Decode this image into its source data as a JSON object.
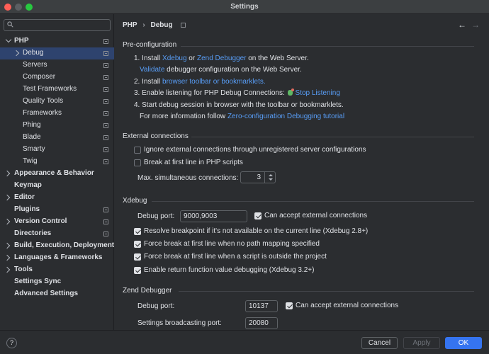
{
  "window": {
    "title": "Settings"
  },
  "search": {
    "placeholder": "",
    "value": ""
  },
  "sidebar": {
    "items": [
      {
        "label": "PHP"
      },
      {
        "label": "Debug"
      },
      {
        "label": "Servers"
      },
      {
        "label": "Composer"
      },
      {
        "label": "Test Frameworks"
      },
      {
        "label": "Quality Tools"
      },
      {
        "label": "Frameworks"
      },
      {
        "label": "Phing"
      },
      {
        "label": "Blade"
      },
      {
        "label": "Smarty"
      },
      {
        "label": "Twig"
      },
      {
        "label": "Appearance & Behavior"
      },
      {
        "label": "Keymap"
      },
      {
        "label": "Editor"
      },
      {
        "label": "Plugins"
      },
      {
        "label": "Version Control"
      },
      {
        "label": "Directories"
      },
      {
        "label": "Build, Execution, Deployment"
      },
      {
        "label": "Languages & Frameworks"
      },
      {
        "label": "Tools"
      },
      {
        "label": "Settings Sync"
      },
      {
        "label": "Advanced Settings"
      }
    ]
  },
  "breadcrumb": {
    "parent": "PHP",
    "separator": "›",
    "current": "Debug"
  },
  "nav": {
    "back": "←",
    "forward": "→"
  },
  "preconfig": {
    "title": "Pre-configuration",
    "step1": {
      "a": "1. Install ",
      "xdebug": "Xdebug",
      "or": " or ",
      "zend": "Zend Debugger",
      "b": " on the Web Server."
    },
    "step1b": {
      "validate": "Validate",
      "rest": " debugger configuration on the Web Server."
    },
    "step2": {
      "a": "2. Install ",
      "link": "browser toolbar or bookmarklets."
    },
    "step3": {
      "a": "3. Enable listening for PHP Debug Connections: ",
      "link": "Stop Listening"
    },
    "step4": {
      "a": "4. Start debug session in browser with the toolbar or bookmarklets."
    },
    "step4b": {
      "a": "For more information follow ",
      "link": "Zero-configuration Debugging tutorial"
    }
  },
  "external": {
    "title": "External connections",
    "ignore_label": "Ignore external connections through unregistered server configurations",
    "ignore_checked": false,
    "break_label": "Break at first line in PHP scripts",
    "break_checked": false,
    "max_label": "Max. simultaneous connections:",
    "max_value": "3"
  },
  "xdebug": {
    "title": "Xdebug",
    "port_label": "Debug port:",
    "port_value": "9000,9003",
    "accept_label": "Can accept external connections",
    "accept_checked": true,
    "resolve_label": "Resolve breakpoint if it's not available on the current line (Xdebug 2.8+)",
    "resolve_checked": true,
    "force1_label": "Force break at first line when no path mapping specified",
    "force1_checked": true,
    "force2_label": "Force break at first line when a script is outside the project",
    "force2_checked": true,
    "ret_label": "Enable return function value debugging (Xdebug 3.2+)",
    "ret_checked": true
  },
  "zend": {
    "title": "Zend Debugger",
    "port_label": "Debug port:",
    "port_value": "10137",
    "accept_label": "Can accept external connections",
    "accept_checked": true,
    "bcast_label": "Settings broadcasting port:",
    "bcast_value": "20080"
  },
  "footer": {
    "help": "?",
    "cancel": "Cancel",
    "apply": "Apply",
    "ok": "OK"
  },
  "colors": {
    "accent": "#3574f0",
    "link": "#589df6",
    "selection": "#2e436e",
    "background": "#2b2d30"
  }
}
